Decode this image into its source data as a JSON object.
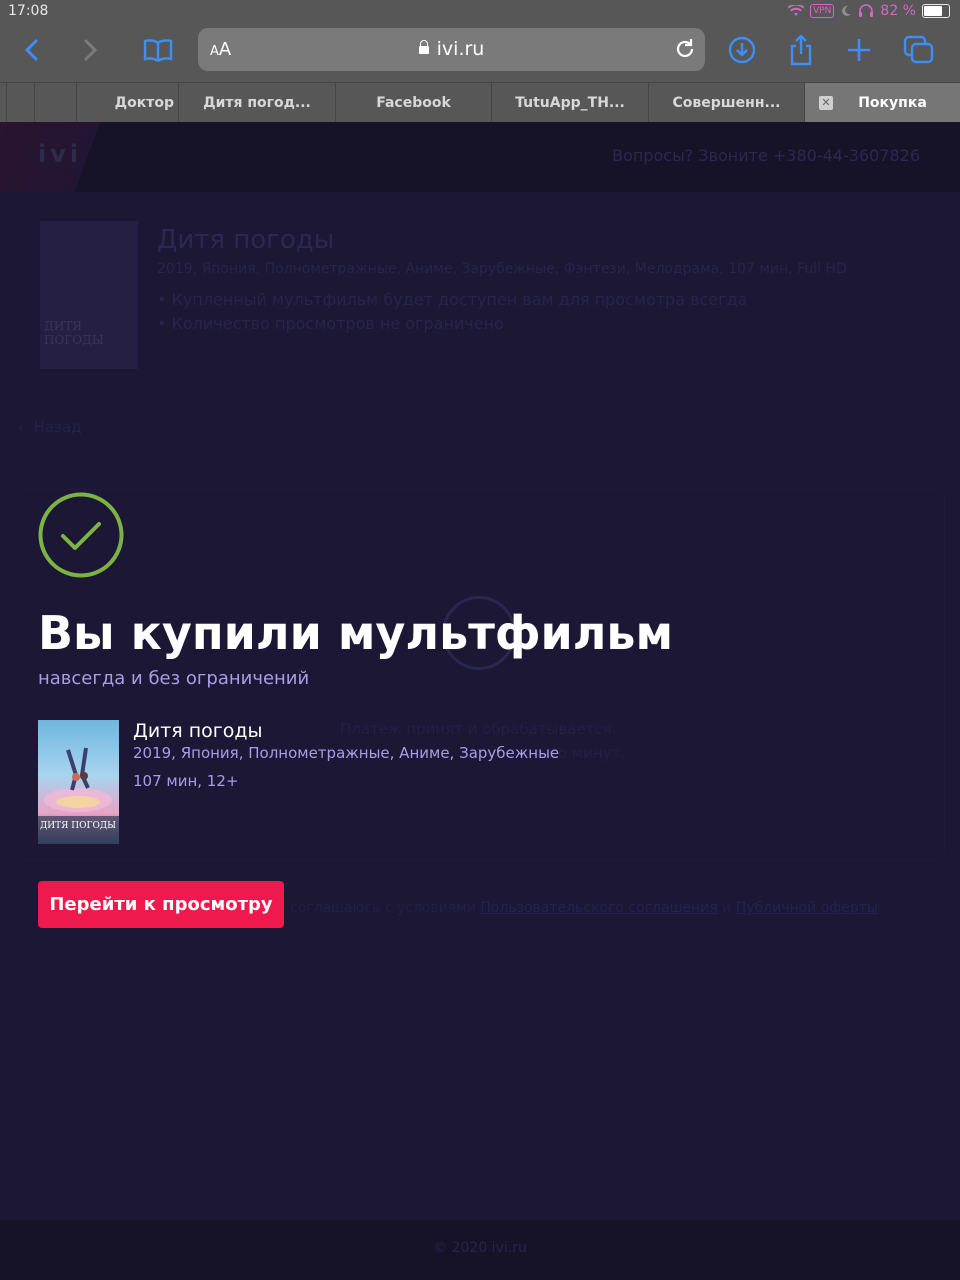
{
  "status_bar": {
    "time": "17:08",
    "vpn": "VPN",
    "battery": "82 %",
    "battery_level": 0.82
  },
  "browser": {
    "address_aa_small": "A",
    "address_aa_large": "A",
    "url": "ivi.ru",
    "tabs": [
      {
        "label": "Доктор"
      },
      {
        "label": "Дитя погод..."
      },
      {
        "label": "Facebook"
      },
      {
        "label": "TutuApp_TH..."
      },
      {
        "label": "Совершенн..."
      },
      {
        "label": "Покупка",
        "active": true
      }
    ]
  },
  "background_page": {
    "phone": "Вопросы? Звоните +380-44-3607826",
    "movie_title": "Дитя погоды",
    "movie_meta": "2019, Япония, Полнометражные, Аниме, Зарубежные, Фэнтези, Мелодрама, 107 мин, Full HD",
    "bullets": [
      "Купленный мультфильм будет доступен вам для просмотра всегда",
      "Количество просмотров не ограничено"
    ],
    "back_label": "Назад",
    "payment_line1": "Платеж принят и обрабатывается.",
    "payment_line2": "ько минут.",
    "agreement_text": "соглашаюсь с условиями",
    "agreement_link1": "Пользовательского соглашения",
    "agreement_and": "и",
    "agreement_link2": "Публичной оферты",
    "footer": "© 2020 ivi.ru"
  },
  "success": {
    "title": "Вы купили мультфильм",
    "subtitle": "навсегда и без ограничений",
    "movie_title": "Дитя погоды",
    "poster_caption": "ДИТЯ ПОГОДЫ",
    "movie_meta": "2019, Япония, Полнометражные, Аниме, Зарубежные",
    "movie_duration": "107 мин, 12+",
    "watch_button": "Перейти к просмотру"
  },
  "colors": {
    "accent": "#f0194e",
    "check": "#7cb342",
    "bg": "#1b1735"
  }
}
